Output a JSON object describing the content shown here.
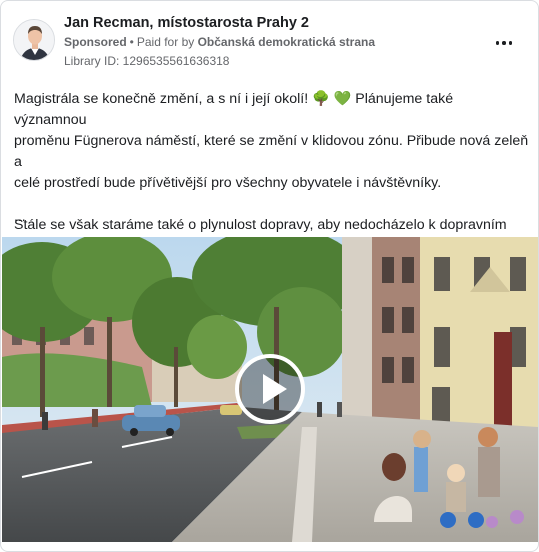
{
  "post": {
    "page_name": "Jan Recman, místostarosta Prahy 2",
    "sponsored_label": "Sponsored",
    "separator": "•",
    "paid_for_prefix": "Paid for by",
    "paid_for_by": "Občanská demokratická strana",
    "library_id": "Library ID: 1296535561636318",
    "text_paragraph_1": "Magistrála se konečně změní, a s ní i její okolí! 🌳 💚 Plánujeme také významnou\nproměnu Fügnerova náměstí, které se změní v klidovou zónu. Přibude nová zeleň a\ncelé prostředí bude přívětivější pro všechny obyvatele i návštěvníky.",
    "text_paragraph_2": "Stále se však staráme také o plynulost dopravy, aby nedocházelo k dopravním\nzácpám, a modernizujeme infrastrukturu pro chodce i cyklisty.",
    "see_more": "..."
  },
  "icons": {
    "more": "more-options-icon",
    "play": "play-icon",
    "avatar": "profile-photo"
  }
}
